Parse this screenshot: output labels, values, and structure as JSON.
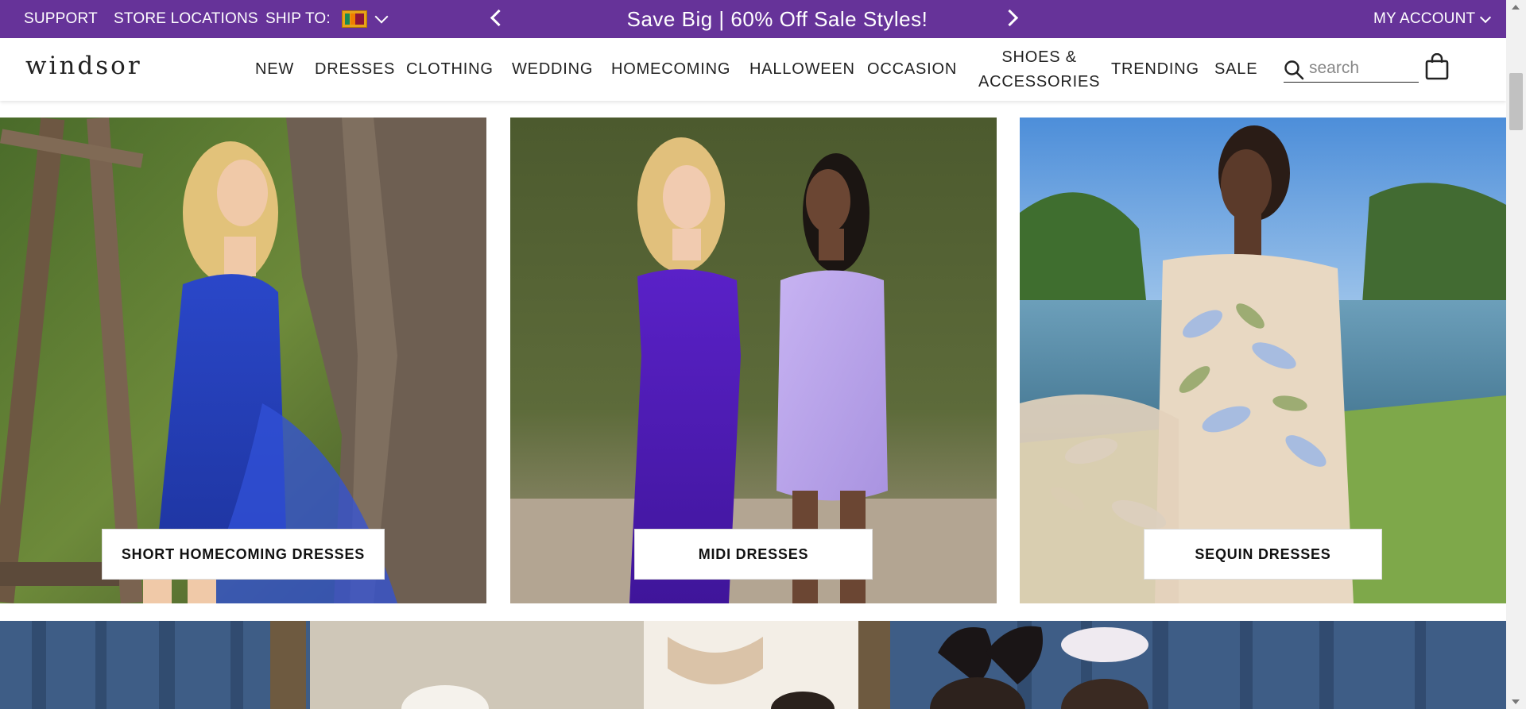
{
  "promo": {
    "support": "SUPPORT",
    "store_locations": "STORE LOCATIONS",
    "ship_to": "SHIP TO:",
    "message": "Save Big | 60% Off Sale Styles!",
    "my_account": "MY ACCOUNT"
  },
  "header": {
    "logo": "windsor",
    "nav": [
      "NEW",
      "DRESSES",
      "CLOTHING",
      "WEDDING",
      "HOMECOMING",
      "HALLOWEEN",
      "OCCASION",
      "SHOES &",
      "ACCESSORIES",
      "TRENDING",
      "SALE"
    ],
    "search_placeholder": "search"
  },
  "tiles": [
    {
      "label": "SHORT HOMECOMING DRESSES"
    },
    {
      "label": "MIDI DRESSES"
    },
    {
      "label": "SEQUIN DRESSES"
    }
  ],
  "colors": {
    "brand": "#663399",
    "text": "#222222",
    "button_bg": "#ffffff"
  }
}
